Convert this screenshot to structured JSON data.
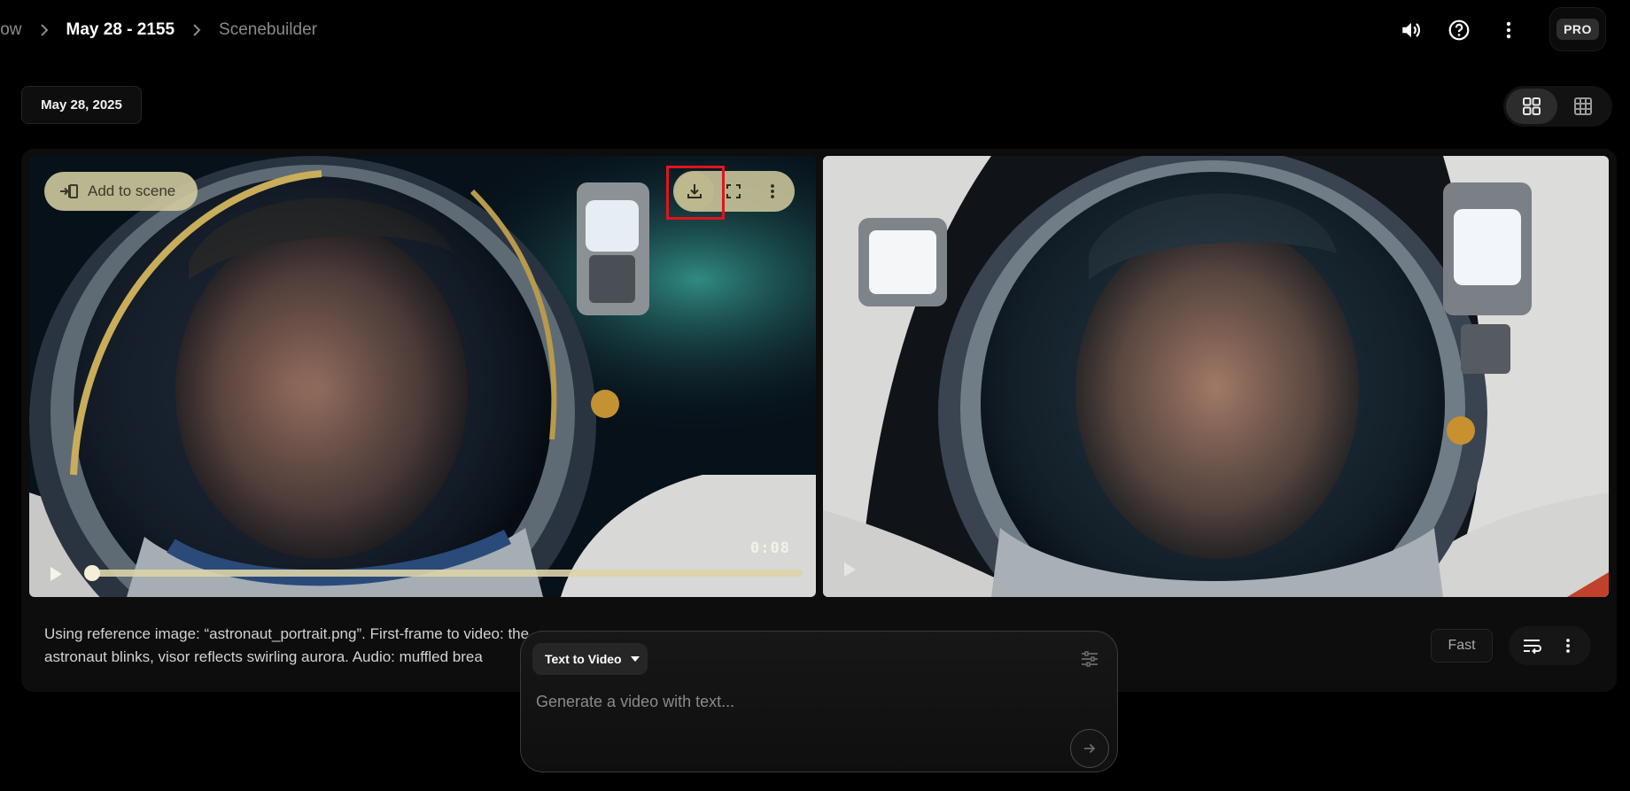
{
  "breadcrumb": {
    "items": [
      "low",
      "May 28 - 2155",
      "Scenebuilder"
    ]
  },
  "top_icons": [
    "volume-icon",
    "help-icon",
    "more-vert-icon"
  ],
  "pro_badge": "PRO",
  "date_chip": "May 28, 2025",
  "view_toggle": {
    "options": [
      "grid-large-icon",
      "grid-small-icon"
    ],
    "active": "grid-large-icon"
  },
  "video_left": {
    "add_to_scene_label": "Add to scene",
    "controls": [
      "download-icon",
      "fullscreen-icon",
      "more-vert-icon"
    ],
    "timecode": "0:08",
    "progress": 0.0
  },
  "video_right": {
    "controls": [
      "play-icon"
    ]
  },
  "prompt_text": "Using reference image: “astronaut_portrait.png”. First-frame to video: the astronaut blinks, visor reflects swirling aurora. Audio: muffled brea",
  "card_chips": {
    "speed": "Fast",
    "actions": [
      "queue-icon",
      "more-vert-icon"
    ]
  },
  "composer": {
    "mode_label": "Text to Video",
    "placeholder": "Generate a video with text...",
    "value": ""
  },
  "colors": {
    "background": "#000000",
    "card": "#0d0d0d",
    "accent_overlay": "#d4cda0",
    "highlight": "#e0141e"
  }
}
